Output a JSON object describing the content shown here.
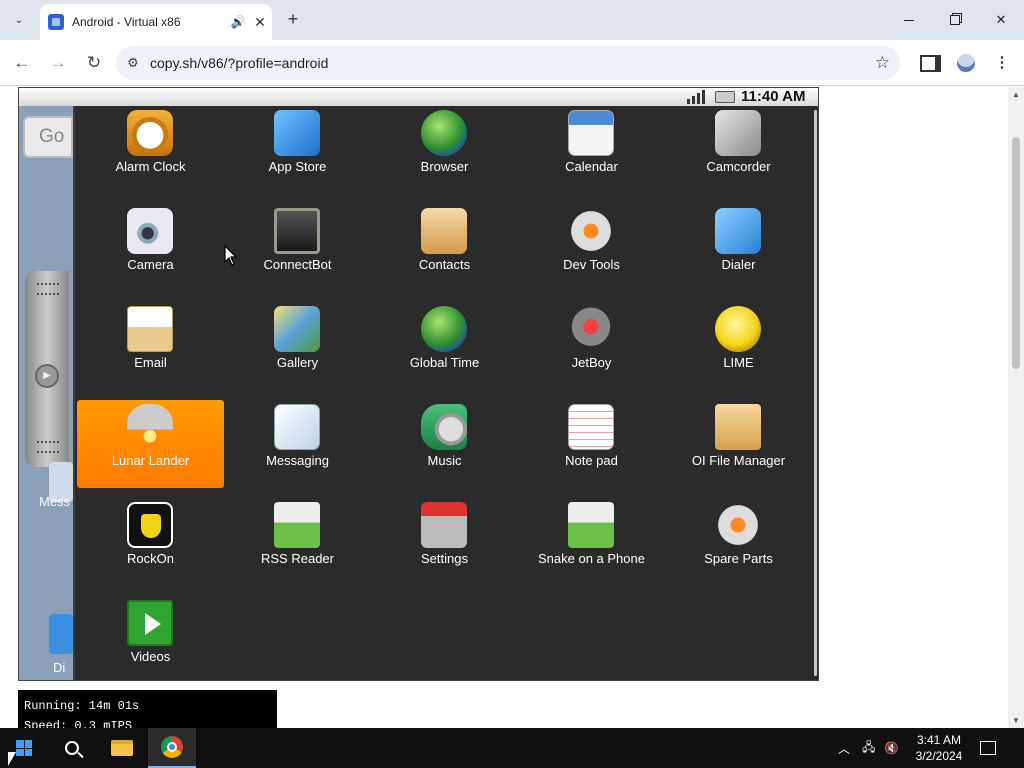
{
  "browser": {
    "tab_title": "Android - Virtual x86",
    "url": "copy.sh/v86/?profile=android",
    "new_tab_label": "+",
    "tab_close_label": "✕",
    "tab_audio_label": "🔊",
    "back_label": "←",
    "forward_label": "→",
    "reload_label": "↻",
    "site_info_label": "⚙",
    "bookmark_label": "☆",
    "menu_label": "⋮",
    "tab_list_label": "⌄",
    "window_close_label": "✕"
  },
  "android": {
    "status_time": "11:40 AM",
    "search_widget_text": "Go",
    "home_label_messaging": "Mess",
    "home_label_dialer": "Di",
    "apps": [
      {
        "label": "Alarm Clock",
        "icon": "alarm-clock-icon",
        "selected": false
      },
      {
        "label": "App Store",
        "icon": "app-store-icon",
        "selected": false
      },
      {
        "label": "Browser",
        "icon": "browser-globe-icon",
        "selected": false
      },
      {
        "label": "Calendar",
        "icon": "calendar-icon",
        "selected": false
      },
      {
        "label": "Camcorder",
        "icon": "camcorder-icon",
        "selected": false
      },
      {
        "label": "Camera",
        "icon": "camera-icon",
        "selected": false
      },
      {
        "label": "ConnectBot",
        "icon": "terminal-icon",
        "selected": false
      },
      {
        "label": "Contacts",
        "icon": "contacts-icon",
        "selected": false
      },
      {
        "label": "Dev Tools",
        "icon": "gear-icon",
        "selected": false
      },
      {
        "label": "Dialer",
        "icon": "phone-icon",
        "selected": false
      },
      {
        "label": "Email",
        "icon": "email-icon",
        "selected": false
      },
      {
        "label": "Gallery",
        "icon": "gallery-icon",
        "selected": false
      },
      {
        "label": "Global Time",
        "icon": "globe-clock-icon",
        "selected": false
      },
      {
        "label": "JetBoy",
        "icon": "jetboy-icon",
        "selected": false
      },
      {
        "label": "LIME",
        "icon": "lime-icon",
        "selected": false
      },
      {
        "label": "Lunar Lander",
        "icon": "lunar-lander-icon",
        "selected": true
      },
      {
        "label": "Messaging",
        "icon": "messaging-icon",
        "selected": false
      },
      {
        "label": "Music",
        "icon": "music-icon",
        "selected": false
      },
      {
        "label": "Note pad",
        "icon": "notepad-icon",
        "selected": false
      },
      {
        "label": "OI File Manager",
        "icon": "folder-icon",
        "selected": false
      },
      {
        "label": "RockOn",
        "icon": "rockon-icon",
        "selected": false
      },
      {
        "label": "RSS Reader",
        "icon": "rss-reader-icon",
        "selected": false
      },
      {
        "label": "Settings",
        "icon": "settings-icon",
        "selected": false
      },
      {
        "label": "Snake on a Phone",
        "icon": "snake-icon",
        "selected": false
      },
      {
        "label": "Spare Parts",
        "icon": "gear-icon",
        "selected": false
      },
      {
        "label": "Videos",
        "icon": "play-icon",
        "selected": false
      }
    ]
  },
  "emulator_info": {
    "running": "Running: 14m 01s",
    "speed": "Speed: 0.3 mIPS"
  },
  "taskbar": {
    "time": "3:41 AM",
    "date": "3/2/2024",
    "tray_chevron_label": "︿"
  },
  "colors": {
    "selected_app_bg": "#ff8a00",
    "drawer_bg": "#2b2b2b",
    "taskbar_bg": "#101010"
  }
}
